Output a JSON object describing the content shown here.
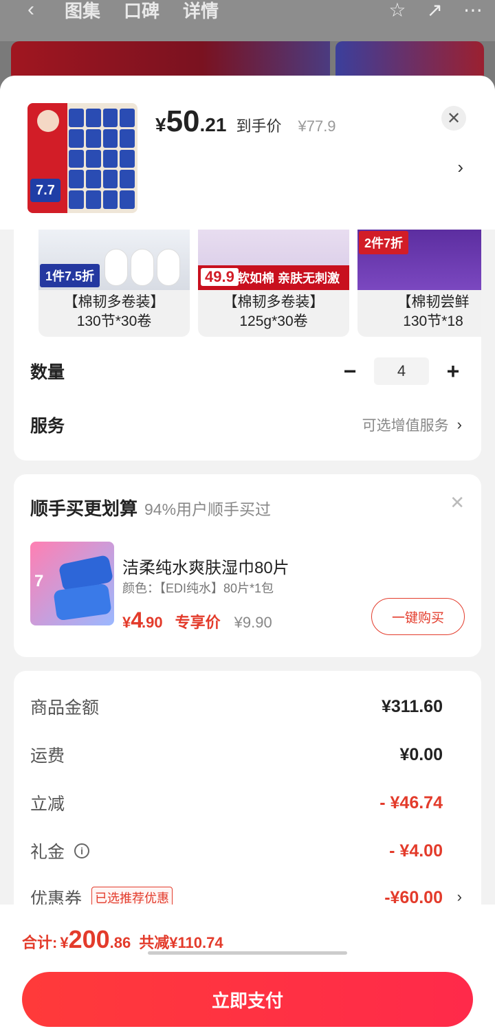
{
  "background": {
    "tabs": [
      "图集",
      "口碑",
      "详情"
    ]
  },
  "sheet": {
    "price_currency": "¥",
    "price_int": "50",
    "price_dec": ".21",
    "price_label": "到手价",
    "original_price": "¥77.9",
    "thumb_discount": "7.7"
  },
  "options": [
    {
      "tag": "1件7.5折",
      "line1": "【棉韧多卷装】",
      "line2": "130节*30卷"
    },
    {
      "tag": "49.9",
      "banner": "柔软如棉 亲肤无刺激",
      "line1": "【棉韧多卷装】",
      "line2": "125g*30卷"
    },
    {
      "tag": "2件7折",
      "line1": "【棉韧尝鲜",
      "line2": "130节*18"
    }
  ],
  "quantity": {
    "label": "数量",
    "value": "4",
    "minus": "−",
    "plus": "+"
  },
  "service": {
    "label": "服务",
    "hint": "可选增值服务"
  },
  "addon": {
    "title": "顺手买更划算",
    "subtitle": "94%用户顺手买过",
    "image_tag": "7",
    "product_name": "洁柔纯水爽肤湿巾80片",
    "spec": "颜色：【EDI纯水】80片*1包",
    "price_c": "¥",
    "price_i": "4",
    "price_d": ".90",
    "price_tag": "专享价",
    "original": "¥9.90",
    "buy_label": "一键购买"
  },
  "summary": [
    {
      "k": "商品金额",
      "v": "¥311.60",
      "red": false
    },
    {
      "k": "运费",
      "v": "¥0.00",
      "red": false
    },
    {
      "k": "立减",
      "v": "- ¥46.74",
      "red": true
    },
    {
      "k": "礼金",
      "v": "- ¥4.00",
      "red": true
    },
    {
      "k": "优惠券",
      "badge": "已选推荐优惠",
      "v": "-¥60.00",
      "red": true
    }
  ],
  "bottom": {
    "total_label": "合计:",
    "total_c": "¥",
    "total_i": "200",
    "total_d": ".86",
    "saved": "共减¥110.74",
    "pay_label": "立即支付"
  },
  "colors": {
    "accent": "#e33b2b",
    "pay": "#ff2f3f"
  }
}
